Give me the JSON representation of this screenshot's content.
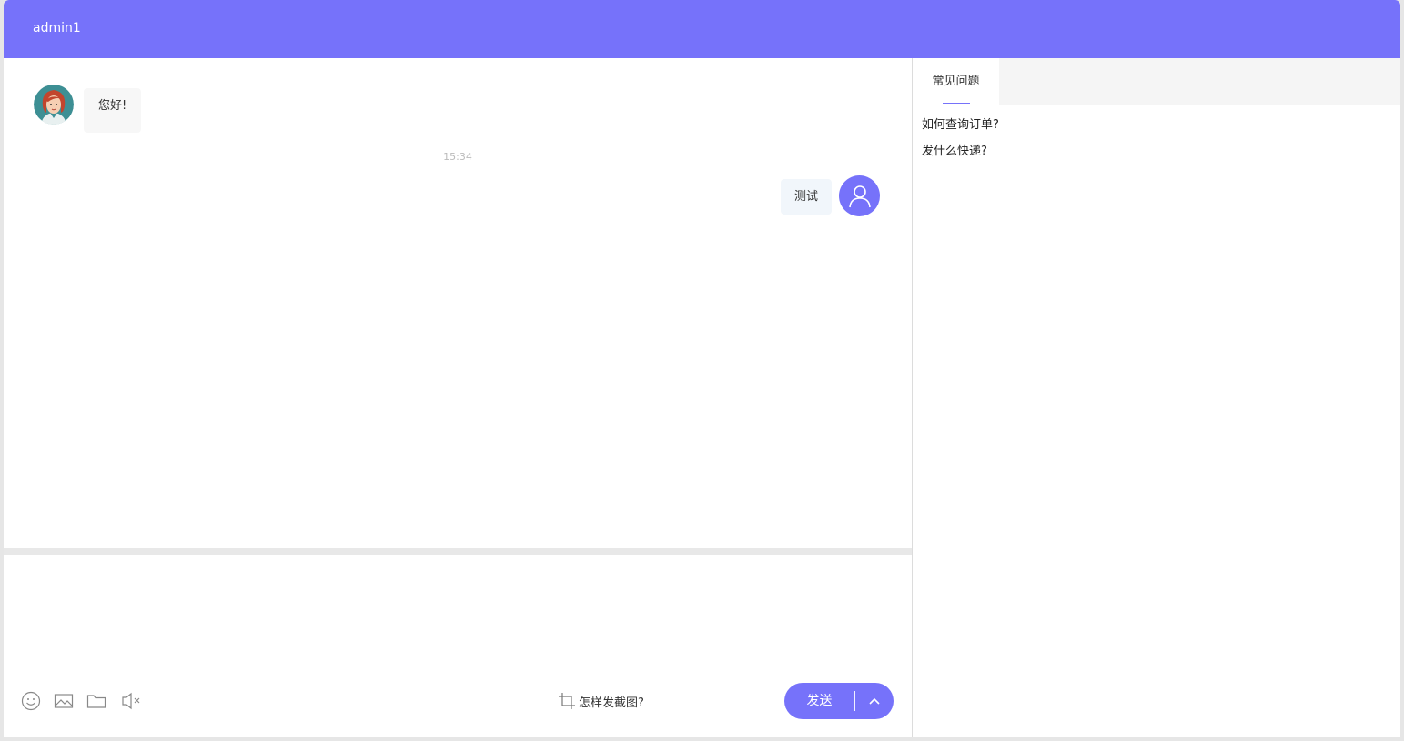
{
  "header": {
    "title": "admin1"
  },
  "messages": [
    {
      "side": "left",
      "text": "您好!",
      "avatar": "agent-avatar"
    },
    {
      "side": "right",
      "text": "测试",
      "avatar": "user-icon"
    }
  ],
  "timestamp": "15:34",
  "composer": {
    "placeholder": "",
    "tools": [
      "emoji-icon",
      "image-icon",
      "folder-icon",
      "sound-off-icon"
    ],
    "screenshot_tip": "怎样发截图?",
    "send_label": "发送"
  },
  "side_panel": {
    "tab_label": "常见问题",
    "faq": [
      "如何查询订单?",
      "发什么快递?"
    ]
  },
  "colors": {
    "accent": "#7672fa"
  }
}
